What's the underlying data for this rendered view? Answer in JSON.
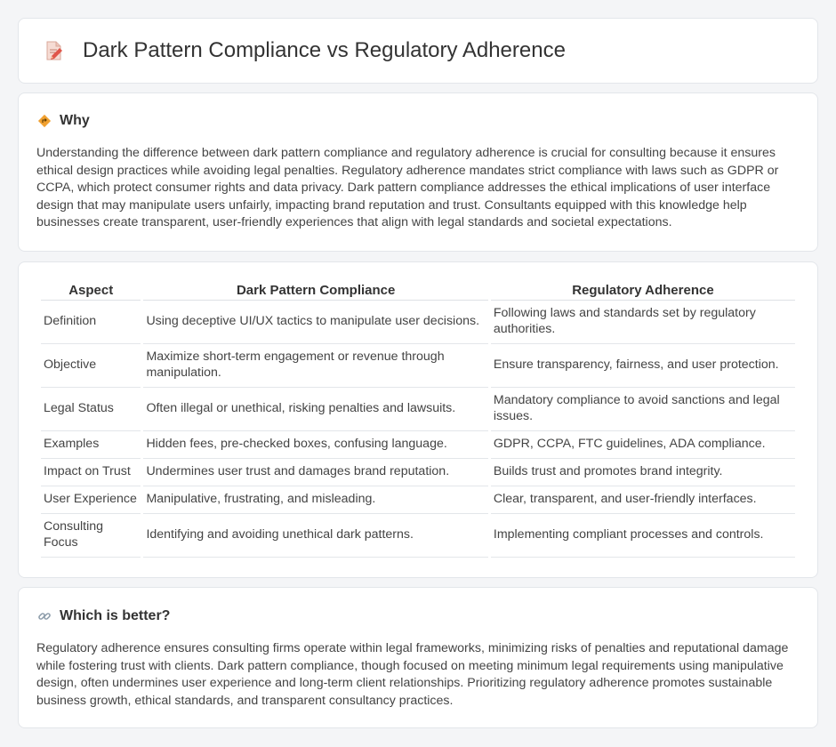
{
  "header": {
    "title": "Dark Pattern Compliance vs Regulatory Adherence",
    "icon": "document-pencil-icon"
  },
  "why": {
    "heading": "Why",
    "icon": "diamond-sign-icon",
    "text": "Understanding the difference between dark pattern compliance and regulatory adherence is crucial for consulting because it ensures ethical design practices while avoiding legal penalties. Regulatory adherence mandates strict compliance with laws such as GDPR or CCPA, which protect consumer rights and data privacy. Dark pattern compliance addresses the ethical implications of user interface design that may manipulate users unfairly, impacting brand reputation and trust. Consultants equipped with this knowledge help businesses create transparent, user-friendly experiences that align with legal standards and societal expectations."
  },
  "table": {
    "headers": [
      "Aspect",
      "Dark Pattern Compliance",
      "Regulatory Adherence"
    ],
    "rows": [
      {
        "aspect": "Definition",
        "dark": "Using deceptive UI/UX tactics to manipulate user decisions.",
        "reg": "Following laws and standards set by regulatory authorities."
      },
      {
        "aspect": "Objective",
        "dark": "Maximize short-term engagement or revenue through manipulation.",
        "reg": "Ensure transparency, fairness, and user protection."
      },
      {
        "aspect": "Legal Status",
        "dark": "Often illegal or unethical, risking penalties and lawsuits.",
        "reg": "Mandatory compliance to avoid sanctions and legal issues."
      },
      {
        "aspect": "Examples",
        "dark": "Hidden fees, pre-checked boxes, confusing language.",
        "reg": "GDPR, CCPA, FTC guidelines, ADA compliance."
      },
      {
        "aspect": "Impact on Trust",
        "dark": "Undermines user trust and damages brand reputation.",
        "reg": "Builds trust and promotes brand integrity."
      },
      {
        "aspect": "User Experience",
        "dark": "Manipulative, frustrating, and misleading.",
        "reg": "Clear, transparent, and user-friendly interfaces."
      },
      {
        "aspect": "Consulting Focus",
        "dark": "Identifying and avoiding unethical dark patterns.",
        "reg": "Implementing compliant processes and controls."
      }
    ]
  },
  "better": {
    "heading": "Which is better?",
    "icon": "link-icon",
    "text": "Regulatory adherence ensures consulting firms operate within legal frameworks, minimizing risks of penalties and reputational damage while fostering trust with clients. Dark pattern compliance, though focused on meeting minimum legal requirements using manipulative design, often undermines user experience and long-term client relationships. Prioritizing regulatory adherence promotes sustainable business growth, ethical standards, and transparent consultancy practices."
  },
  "colors": {
    "background": "#f4f5f7",
    "card": "#ffffff",
    "accent_orange": "#f0a030",
    "pencil_red": "#e0564a"
  }
}
